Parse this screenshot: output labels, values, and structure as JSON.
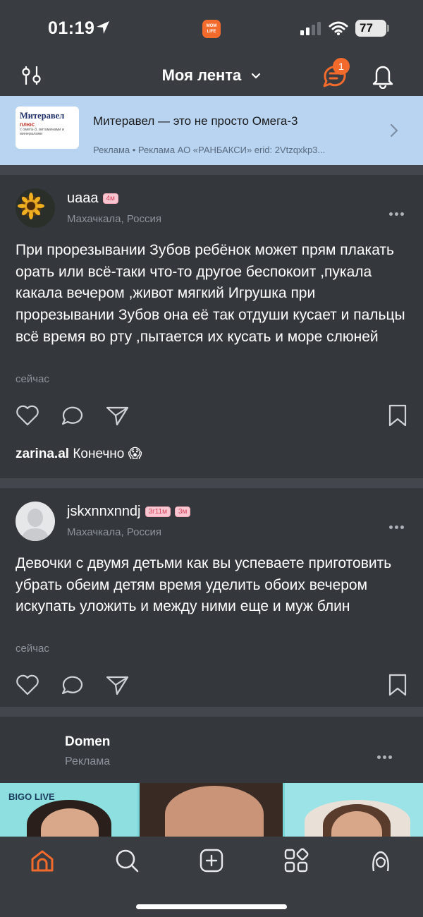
{
  "status_bar": {
    "time": "01:19",
    "battery": "77",
    "app_badge": "MOM LIFE"
  },
  "header": {
    "title": "Моя лента",
    "chat_badge": "1"
  },
  "ad_banner": {
    "logo_line1": "Митеравел",
    "logo_line2": "плюс",
    "logo_line3": "с омега-3, витаминами и минералами",
    "title": "Митеравел — это не просто Омега-3",
    "subtitle": "Реклама  •  Реклама АО «РАНБАКСИ» erid: 2Vtzqxkp3..."
  },
  "posts": [
    {
      "username": "uaaa",
      "tags": [
        "4м"
      ],
      "location": "Махачкала, Россия",
      "text": "При прорезывании Зубов ребёнок может прям плакать орать или всё-таки что-то другое беспокоит ,пукала какала вечером ,живот мягкий Игрушка при прорезывании Зубов она её так отдуши кусает и пальцы всё время во рту ,пытается их кусать и море слюней",
      "time": "сейчас",
      "comment_user": "zarina.al",
      "comment_text": "Конечно 😱"
    },
    {
      "username": "jskxnnxnndj",
      "tags": [
        "3г11м",
        "3м"
      ],
      "location": "Махачкала, Россия",
      "text": "Девочки с двумя детьми как вы успеваете приготовить убрать обеим детям время уделить обоих вечером искупать уложить и между ними еще и муж блин",
      "time": "сейчас"
    }
  ],
  "ad_post": {
    "name": "Domen",
    "label": "Реклама",
    "brand": "BIGO LIVE"
  },
  "colors": {
    "accent": "#f26a2c",
    "background": "#2e3136",
    "card": "#34373c",
    "banner": "#b8d4f0"
  },
  "icons": [
    "location-arrow-icon",
    "signal-icon",
    "wifi-icon",
    "filter-icon",
    "chevron-down-icon",
    "chat-icon",
    "bell-icon",
    "chevron-right-icon",
    "heart-icon",
    "comment-icon",
    "share-icon",
    "bookmark-icon",
    "home-icon",
    "search-icon",
    "add-icon",
    "apps-icon",
    "profile-icon"
  ]
}
